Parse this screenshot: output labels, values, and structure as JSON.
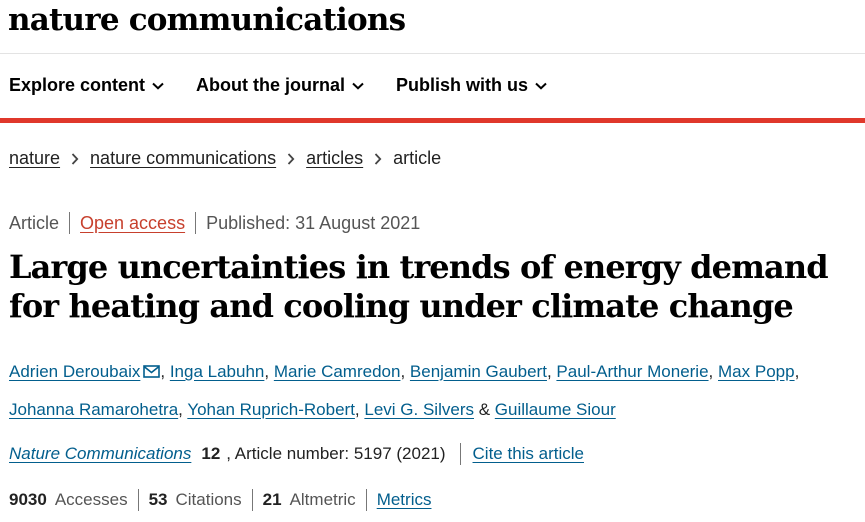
{
  "header": {
    "logo": "nature communications"
  },
  "nav": {
    "items": [
      {
        "label": "Explore content"
      },
      {
        "label": "About the journal"
      },
      {
        "label": "Publish with us"
      }
    ]
  },
  "breadcrumb": [
    "nature",
    "nature communications",
    "articles",
    "article"
  ],
  "meta": {
    "type": "Article",
    "access": "Open access",
    "published": "Published: 31 August 2021"
  },
  "title": "Large uncertainties in trends of energy demand for heating and cooling under climate change",
  "authors": [
    "Adrien Deroubaix",
    "Inga Labuhn",
    "Marie Camredon",
    "Benjamin Gaubert",
    "Paul-Arthur Monerie",
    "Max Popp",
    "Johanna Ramarohetra",
    "Yohan Ruprich-Robert",
    "Levi G. Silvers",
    "Guillaume Siour"
  ],
  "author_sep": {
    "comma": ",",
    "and": "&"
  },
  "citation": {
    "journal": "Nature Communications",
    "volume": "12",
    "details": ", Article number: 5197 (2021)",
    "cite_label": "Cite this article"
  },
  "metrics": {
    "accesses_value": "9030",
    "accesses_label": "Accesses",
    "citations_value": "53",
    "citations_label": "Citations",
    "altmetric_value": "21",
    "altmetric_label": "Altmetric",
    "metrics_link": "Metrics"
  },
  "icons": {
    "nav_dropdown": "chevron-down-icon",
    "breadcrumb_separator": "chevron-right-icon",
    "corresponding_author": "envelope-icon"
  },
  "colors": {
    "accent_red": "#e0382b",
    "link_blue": "#025e8d",
    "open_access": "#c7402d"
  }
}
